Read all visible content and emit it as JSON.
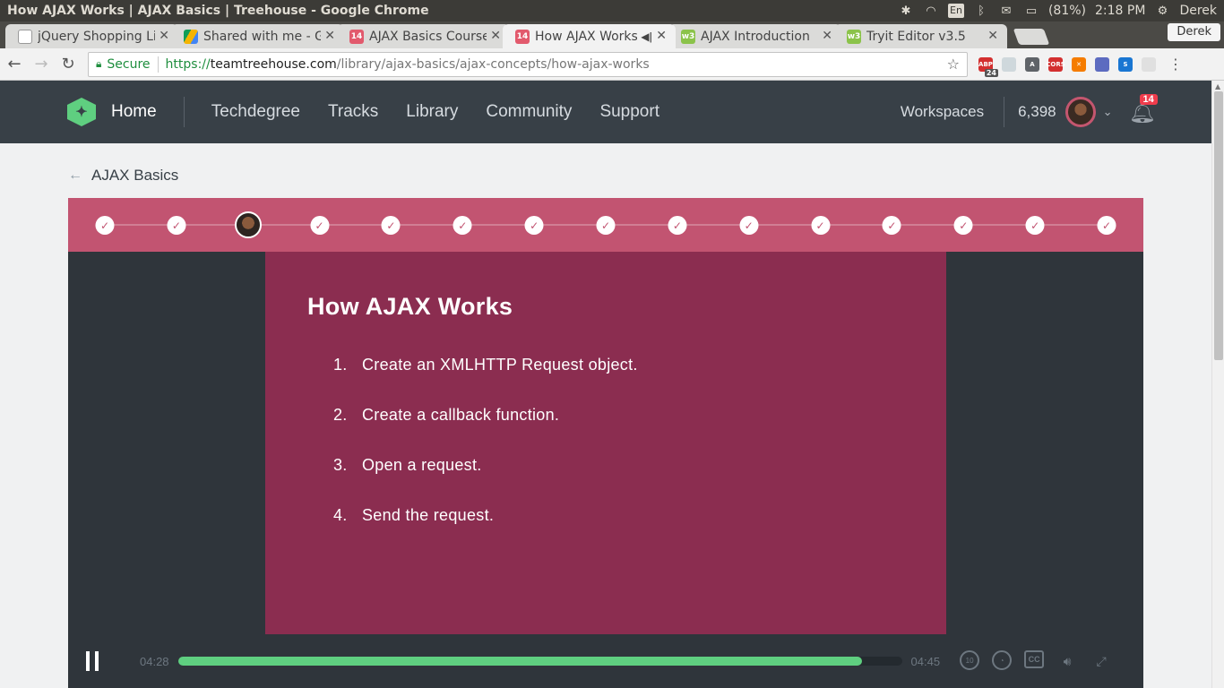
{
  "os": {
    "window_title": "How AJAX Works | AJAX Basics | Treehouse - Google Chrome",
    "language": "En",
    "battery": "(81%)",
    "clock": "2:18 PM",
    "user": "Derek"
  },
  "browser": {
    "tabs": [
      {
        "label": "jQuery Shopping Li",
        "favicon_color": "#ffffff"
      },
      {
        "label": "Shared with me - Go",
        "favicon_color": "#f4b400"
      },
      {
        "label": "AJAX Basics Course",
        "favicon_color": "#e8eaed"
      },
      {
        "label": "How AJAX Works",
        "favicon_color": "#e8eaed"
      },
      {
        "label": "AJAX Introduction",
        "favicon_color": "#8bc34a"
      },
      {
        "label": "Tryit Editor v3.5",
        "favicon_color": "#8bc34a"
      }
    ],
    "tab_badge": "14",
    "profile_name": "Derek",
    "secure_label": "Secure",
    "url_scheme": "https://",
    "url_host": "teamtreehouse.com",
    "url_path": "/library/ajax-basics/ajax-concepts/how-ajax-works",
    "extensions": [
      {
        "name": "adblock-icon",
        "color": "#d32f2f",
        "text": "ABP",
        "badge": "24"
      },
      {
        "name": "extension-icon",
        "color": "#cfd8dc",
        "text": "",
        "badge": ""
      },
      {
        "name": "angular-icon",
        "color": "#5f6368",
        "text": "A",
        "badge": ""
      },
      {
        "name": "cors-icon",
        "color": "#d32f2f",
        "text": "CORS",
        "badge": ""
      },
      {
        "name": "orange-extension-icon",
        "color": "#f57c00",
        "text": "✕",
        "badge": ""
      },
      {
        "name": "eyedropper-icon",
        "color": "#5c6bc0",
        "text": "",
        "badge": ""
      },
      {
        "name": "s-extension-icon",
        "color": "#1976d2",
        "text": "S",
        "badge": ""
      },
      {
        "name": "cast-icon",
        "color": "#e0e0e0",
        "text": "",
        "badge": ""
      }
    ]
  },
  "site": {
    "home": "Home",
    "nav": [
      "Techdegree",
      "Tracks",
      "Library",
      "Community",
      "Support"
    ],
    "workspaces": "Workspaces",
    "points": "6,398",
    "notifications": "14",
    "brand_color": "#5fcf80"
  },
  "breadcrumb": {
    "back_label": "AJAX Basics"
  },
  "steps": {
    "count": 15,
    "current_index": 2,
    "accent": "#c25471"
  },
  "slide": {
    "title": "How AJAX Works",
    "items": [
      {
        "num": "1.",
        "text": "Create an XMLHTTP Request object."
      },
      {
        "num": "2.",
        "text": "Create a callback function."
      },
      {
        "num": "3.",
        "text": "Open a request."
      },
      {
        "num": "4.",
        "text": "Send the request."
      }
    ],
    "background": "#8b2d50"
  },
  "player": {
    "current_time": "04:28",
    "duration": "04:45",
    "progress_fraction": 0.945,
    "rewind_label": "10"
  }
}
